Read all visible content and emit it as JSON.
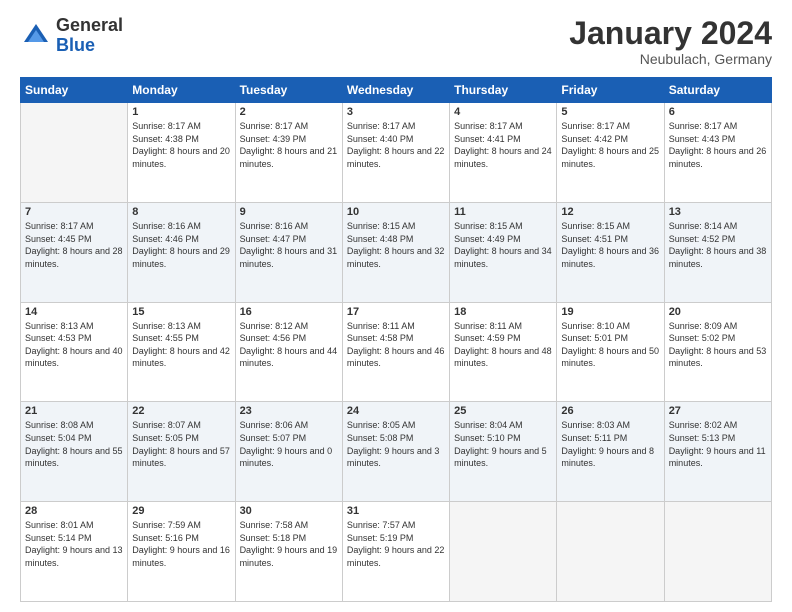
{
  "header": {
    "logo_general": "General",
    "logo_blue": "Blue",
    "month_title": "January 2024",
    "location": "Neubulach, Germany"
  },
  "weekdays": [
    "Sunday",
    "Monday",
    "Tuesday",
    "Wednesday",
    "Thursday",
    "Friday",
    "Saturday"
  ],
  "weeks": [
    [
      {
        "day": "",
        "empty": true
      },
      {
        "day": "1",
        "sunrise": "8:17 AM",
        "sunset": "4:38 PM",
        "daylight": "8 hours and 20 minutes."
      },
      {
        "day": "2",
        "sunrise": "8:17 AM",
        "sunset": "4:39 PM",
        "daylight": "8 hours and 21 minutes."
      },
      {
        "day": "3",
        "sunrise": "8:17 AM",
        "sunset": "4:40 PM",
        "daylight": "8 hours and 22 minutes."
      },
      {
        "day": "4",
        "sunrise": "8:17 AM",
        "sunset": "4:41 PM",
        "daylight": "8 hours and 24 minutes."
      },
      {
        "day": "5",
        "sunrise": "8:17 AM",
        "sunset": "4:42 PM",
        "daylight": "8 hours and 25 minutes."
      },
      {
        "day": "6",
        "sunrise": "8:17 AM",
        "sunset": "4:43 PM",
        "daylight": "8 hours and 26 minutes."
      }
    ],
    [
      {
        "day": "7",
        "sunrise": "8:17 AM",
        "sunset": "4:45 PM",
        "daylight": "8 hours and 28 minutes."
      },
      {
        "day": "8",
        "sunrise": "8:16 AM",
        "sunset": "4:46 PM",
        "daylight": "8 hours and 29 minutes."
      },
      {
        "day": "9",
        "sunrise": "8:16 AM",
        "sunset": "4:47 PM",
        "daylight": "8 hours and 31 minutes."
      },
      {
        "day": "10",
        "sunrise": "8:15 AM",
        "sunset": "4:48 PM",
        "daylight": "8 hours and 32 minutes."
      },
      {
        "day": "11",
        "sunrise": "8:15 AM",
        "sunset": "4:49 PM",
        "daylight": "8 hours and 34 minutes."
      },
      {
        "day": "12",
        "sunrise": "8:15 AM",
        "sunset": "4:51 PM",
        "daylight": "8 hours and 36 minutes."
      },
      {
        "day": "13",
        "sunrise": "8:14 AM",
        "sunset": "4:52 PM",
        "daylight": "8 hours and 38 minutes."
      }
    ],
    [
      {
        "day": "14",
        "sunrise": "8:13 AM",
        "sunset": "4:53 PM",
        "daylight": "8 hours and 40 minutes."
      },
      {
        "day": "15",
        "sunrise": "8:13 AM",
        "sunset": "4:55 PM",
        "daylight": "8 hours and 42 minutes."
      },
      {
        "day": "16",
        "sunrise": "8:12 AM",
        "sunset": "4:56 PM",
        "daylight": "8 hours and 44 minutes."
      },
      {
        "day": "17",
        "sunrise": "8:11 AM",
        "sunset": "4:58 PM",
        "daylight": "8 hours and 46 minutes."
      },
      {
        "day": "18",
        "sunrise": "8:11 AM",
        "sunset": "4:59 PM",
        "daylight": "8 hours and 48 minutes."
      },
      {
        "day": "19",
        "sunrise": "8:10 AM",
        "sunset": "5:01 PM",
        "daylight": "8 hours and 50 minutes."
      },
      {
        "day": "20",
        "sunrise": "8:09 AM",
        "sunset": "5:02 PM",
        "daylight": "8 hours and 53 minutes."
      }
    ],
    [
      {
        "day": "21",
        "sunrise": "8:08 AM",
        "sunset": "5:04 PM",
        "daylight": "8 hours and 55 minutes."
      },
      {
        "day": "22",
        "sunrise": "8:07 AM",
        "sunset": "5:05 PM",
        "daylight": "8 hours and 57 minutes."
      },
      {
        "day": "23",
        "sunrise": "8:06 AM",
        "sunset": "5:07 PM",
        "daylight": "9 hours and 0 minutes."
      },
      {
        "day": "24",
        "sunrise": "8:05 AM",
        "sunset": "5:08 PM",
        "daylight": "9 hours and 3 minutes."
      },
      {
        "day": "25",
        "sunrise": "8:04 AM",
        "sunset": "5:10 PM",
        "daylight": "9 hours and 5 minutes."
      },
      {
        "day": "26",
        "sunrise": "8:03 AM",
        "sunset": "5:11 PM",
        "daylight": "9 hours and 8 minutes."
      },
      {
        "day": "27",
        "sunrise": "8:02 AM",
        "sunset": "5:13 PM",
        "daylight": "9 hours and 11 minutes."
      }
    ],
    [
      {
        "day": "28",
        "sunrise": "8:01 AM",
        "sunset": "5:14 PM",
        "daylight": "9 hours and 13 minutes."
      },
      {
        "day": "29",
        "sunrise": "7:59 AM",
        "sunset": "5:16 PM",
        "daylight": "9 hours and 16 minutes."
      },
      {
        "day": "30",
        "sunrise": "7:58 AM",
        "sunset": "5:18 PM",
        "daylight": "9 hours and 19 minutes."
      },
      {
        "day": "31",
        "sunrise": "7:57 AM",
        "sunset": "5:19 PM",
        "daylight": "9 hours and 22 minutes."
      },
      {
        "day": "",
        "empty": true
      },
      {
        "day": "",
        "empty": true
      },
      {
        "day": "",
        "empty": true
      }
    ]
  ],
  "labels": {
    "sunrise": "Sunrise:",
    "sunset": "Sunset:",
    "daylight": "Daylight:"
  }
}
